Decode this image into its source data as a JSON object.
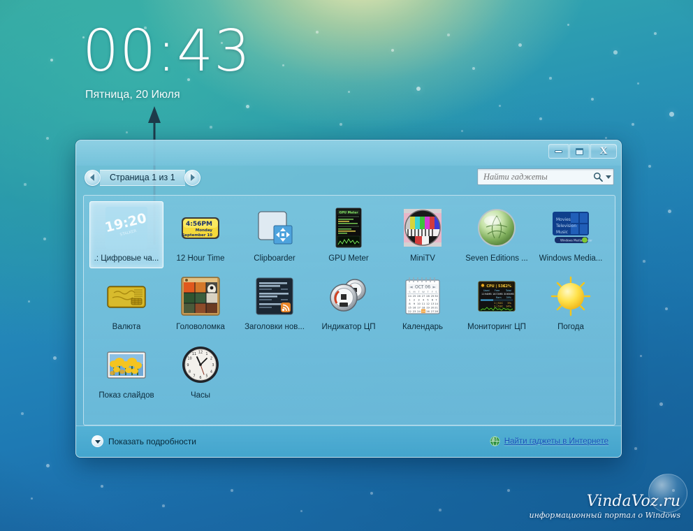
{
  "desktop": {
    "clock": {
      "time": "00:43",
      "date": "Пятница, 20 Июля"
    },
    "watermark": {
      "title": "VindaVoz.ru",
      "subtitle": "информационный портал о Windows"
    }
  },
  "window": {
    "controls": {
      "minimize_label": "Свернуть",
      "maximize_label": "Развернуть",
      "close_label": "Закрыть"
    },
    "toolbar": {
      "prev_label": "Назад",
      "next_label": "Вперед",
      "page_label": "Страница 1 из 1",
      "search_placeholder": "Найти гаджеты",
      "search_value": ""
    },
    "footer": {
      "show_details_label": "Показать подробности",
      "online_link_label": "Найти гаджеты в Интернете"
    },
    "gadgets": [
      {
        "label": ".: Цифровые ча...",
        "icon": "digital-clock-stalker",
        "selected": true
      },
      {
        "label": "12 Hour Time",
        "icon": "twelve-hour-time",
        "selected": false
      },
      {
        "label": "Clipboarder",
        "icon": "clipboarder",
        "selected": false
      },
      {
        "label": "GPU Meter",
        "icon": "gpu-meter",
        "selected": false
      },
      {
        "label": "MiniTV",
        "icon": "mini-tv",
        "selected": false
      },
      {
        "label": "Seven Editions ...",
        "icon": "seven-editions",
        "selected": false
      },
      {
        "label": "Windows Media...",
        "icon": "windows-media-center",
        "selected": false
      },
      {
        "label": "Валюта",
        "icon": "currency-card",
        "selected": false
      },
      {
        "label": "Головоломка",
        "icon": "picture-puzzle",
        "selected": false
      },
      {
        "label": "Заголовки нов...",
        "icon": "news-feed-headlines",
        "selected": false
      },
      {
        "label": "Индикатор ЦП",
        "icon": "cpu-gauge",
        "selected": false
      },
      {
        "label": "Календарь",
        "icon": "calendar",
        "selected": false
      },
      {
        "label": "Мониторинг ЦП",
        "icon": "cpu-monitor",
        "selected": false
      },
      {
        "label": "Погода",
        "icon": "weather-sun",
        "selected": false
      },
      {
        "label": "Показ слайдов",
        "icon": "slideshow-tulips",
        "selected": false
      },
      {
        "label": "Часы",
        "icon": "analog-clock",
        "selected": false
      }
    ],
    "gadget_icon_text": {
      "digital_clock_time": "19:20",
      "digital_clock_brand": "STALKER",
      "twelve_hour_time": "4:56PM",
      "twelve_hour_day": "Monday",
      "twelve_hour_date": "September 10",
      "gpu_meter_title": "GPU Meter",
      "wmc_line1": "Movies",
      "wmc_line2": "Television",
      "wmc_line3": "Music",
      "wmc_footer": "Windows Media Center",
      "calendar_month": "OCT 06",
      "cpu_monitor_title": "CPU | 53C",
      "cpu_monitor_pct": "12%"
    }
  },
  "colors": {
    "accent": "#2894b4",
    "window_glass": "#80c7e0",
    "link": "#1550b8",
    "selection": "#d5eefa"
  }
}
